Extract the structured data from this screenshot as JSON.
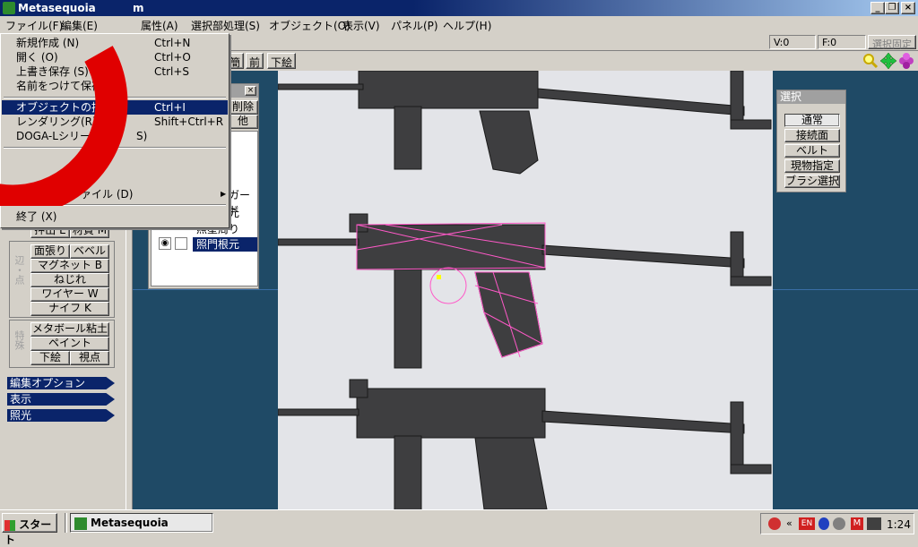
{
  "window": {
    "title": "Metasequoia",
    "title_suffix": "m"
  },
  "menubar": {
    "items": [
      "ファイル(F)",
      "編集(E)",
      "属性(A)",
      "選択部処理(S)",
      "オブジェクト(O)",
      "表示(V)",
      "パネル(P)",
      "ヘルプ(H)"
    ]
  },
  "status": {
    "v": "V:0",
    "f": "F:0",
    "lock": "選択固定"
  },
  "toolbar": {
    "buttons": [
      "簡",
      "前",
      "下絵"
    ]
  },
  "file_menu": {
    "items": [
      {
        "label": "新規作成 (N)",
        "shortcut": "Ctrl+N"
      },
      {
        "label": "開く (O)",
        "shortcut": "Ctrl+O"
      },
      {
        "label": "上書き保存 (S)",
        "shortcut": "Ctrl+S"
      },
      {
        "label": "名前をつけて保存 (A)",
        "shortcut": ""
      },
      {
        "label": "オブジェクトの挿入 (I)",
        "shortcut": "Ctrl+I"
      },
      {
        "label": "レンダリング(R)",
        "shortcut": "Shift+Ctrl+R"
      },
      {
        "label": "DOGA-Lシリーズへ",
        "shortcut": "S)"
      },
      {
        "label": "最近使ったファイル (D)",
        "shortcut": ""
      },
      {
        "label": "終了 (X)",
        "shortcut": ""
      }
    ]
  },
  "left_panel": {
    "row1": [
      "押出 E",
      "材質 M"
    ],
    "group_edge_label": "辺・点",
    "edge_buttons": [
      "面張り",
      "ベベル",
      "マグネット B",
      "ねじれ",
      "ワイヤー W",
      "ナイフ K"
    ],
    "group_special_label": "特殊",
    "special_buttons": [
      "メタボール粘土",
      "ペイント",
      "下絵",
      "視点"
    ],
    "nav": [
      "編集オプション",
      "表示",
      "照光"
    ]
  },
  "object_panel": {
    "buttons": [
      "削除",
      "他"
    ],
    "items": [
      "ガード",
      "元",
      "照星周り",
      "照門根元"
    ]
  },
  "select_panel": {
    "title": "選択",
    "buttons": [
      "通常",
      "接続面",
      "ベルト",
      "現物指定",
      "ブラシ選択"
    ]
  },
  "taskbar": {
    "start": "スタート",
    "task": "Metasequoia",
    "clock": "1:24",
    "tray_en": "EN",
    "tray_m": "M",
    "tray_chev": "«"
  }
}
